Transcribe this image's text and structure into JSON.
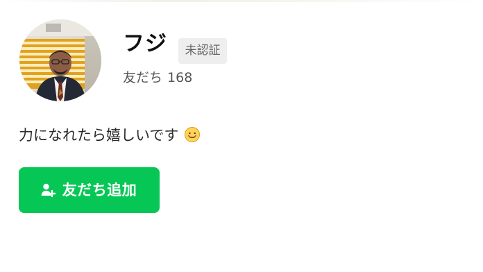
{
  "profile": {
    "name": "フジ",
    "verification_badge": "未認証",
    "friends_label": "友だち",
    "friends_count": "168",
    "status_message": "力になれたら嬉しいです"
  },
  "actions": {
    "add_friend_label": "友だち追加"
  },
  "colors": {
    "primary_green": "#06c755",
    "badge_bg": "#eeeeee",
    "badge_text": "#666666"
  },
  "icons": {
    "avatar": "profile-photo",
    "emoji": "smiling-face-icon",
    "add_friend": "person-add-icon"
  }
}
